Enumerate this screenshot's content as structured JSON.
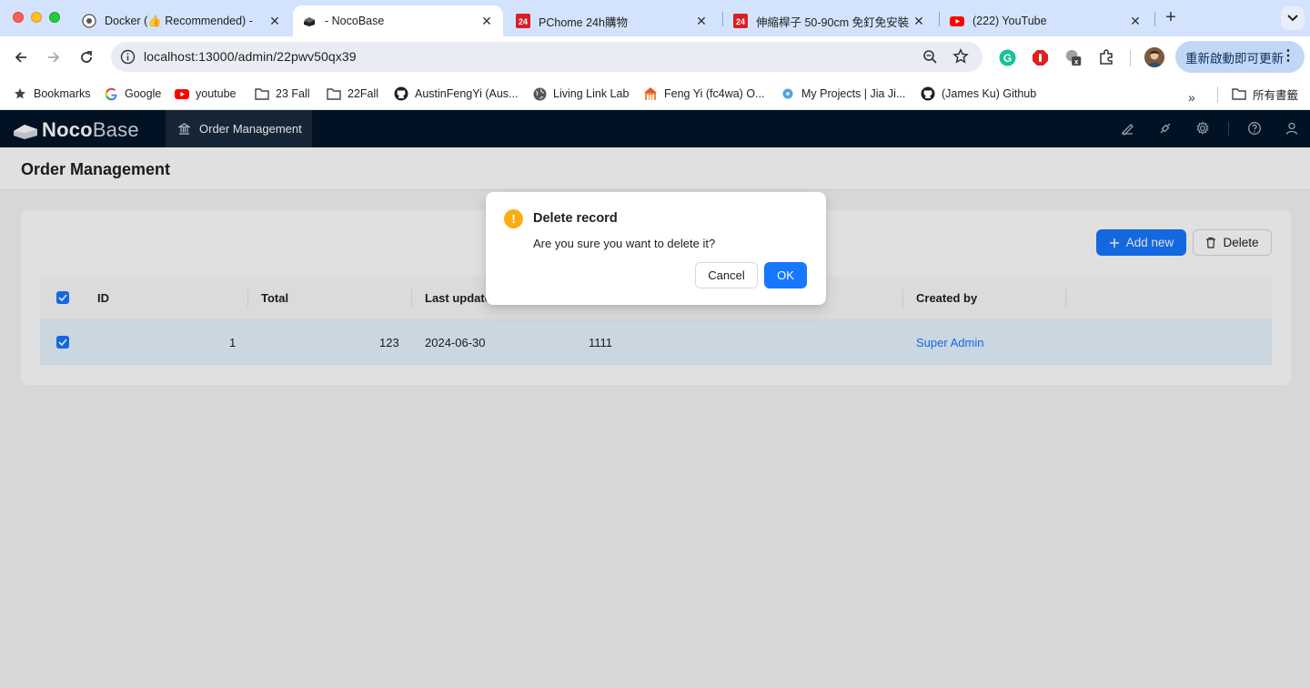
{
  "browser": {
    "tabs": [
      {
        "title": "Docker (👍 Recommended) -",
        "favicon": "github-icon",
        "active": false
      },
      {
        "title": "- NocoBase",
        "favicon": "nocobase-icon",
        "active": true
      },
      {
        "title": "PChome 24h購物",
        "favicon": "pchome-icon",
        "active": false
      },
      {
        "title": "伸縮桿子 50-90cm 免釘免安裝",
        "favicon": "pchome-icon",
        "active": false
      },
      {
        "title": "(222) YouTube",
        "favicon": "youtube-icon",
        "active": false
      }
    ],
    "url": "localhost:13000/admin/22pwv50qx39",
    "update_label": "重新啟動即可更新",
    "bookmarks": [
      {
        "label": "Bookmarks",
        "icon": "star-icon"
      },
      {
        "label": "Google",
        "icon": "google-icon"
      },
      {
        "label": "youtube",
        "icon": "youtube-icon"
      },
      {
        "label": "23 Fall",
        "icon": "folder-icon"
      },
      {
        "label": "22Fall",
        "icon": "folder-icon"
      },
      {
        "label": "AustinFengYi (Aus...",
        "icon": "github-icon"
      },
      {
        "label": "Living Link Lab",
        "icon": "globe-icon"
      },
      {
        "label": "Feng Yi (fc4wa) O...",
        "icon": "building-icon"
      },
      {
        "label": "My Projects | Jia Ji...",
        "icon": "project-icon"
      },
      {
        "label": "(James Ku) Github",
        "icon": "github-icon"
      }
    ],
    "all_bookmarks_label": "所有書籤"
  },
  "app": {
    "logo_bold": "Noco",
    "logo_light": "Base",
    "menu_item": "Order Management",
    "page_title": "Order Management",
    "add_new_label": "Add new",
    "delete_label": "Delete",
    "table": {
      "headers": [
        "ID",
        "Total",
        "Last update",
        "Created by"
      ],
      "rows": [
        {
          "id": "1",
          "total": "123",
          "date": "2024-06-30",
          "extra": "1111",
          "created_by": "Super Admin"
        }
      ]
    }
  },
  "modal": {
    "title": "Delete record",
    "content": "Are you sure you want to delete it?",
    "cancel_label": "Cancel",
    "ok_label": "OK"
  },
  "colors": {
    "primary": "#1677ff",
    "header_bg": "#001529",
    "warning": "#faad14"
  }
}
